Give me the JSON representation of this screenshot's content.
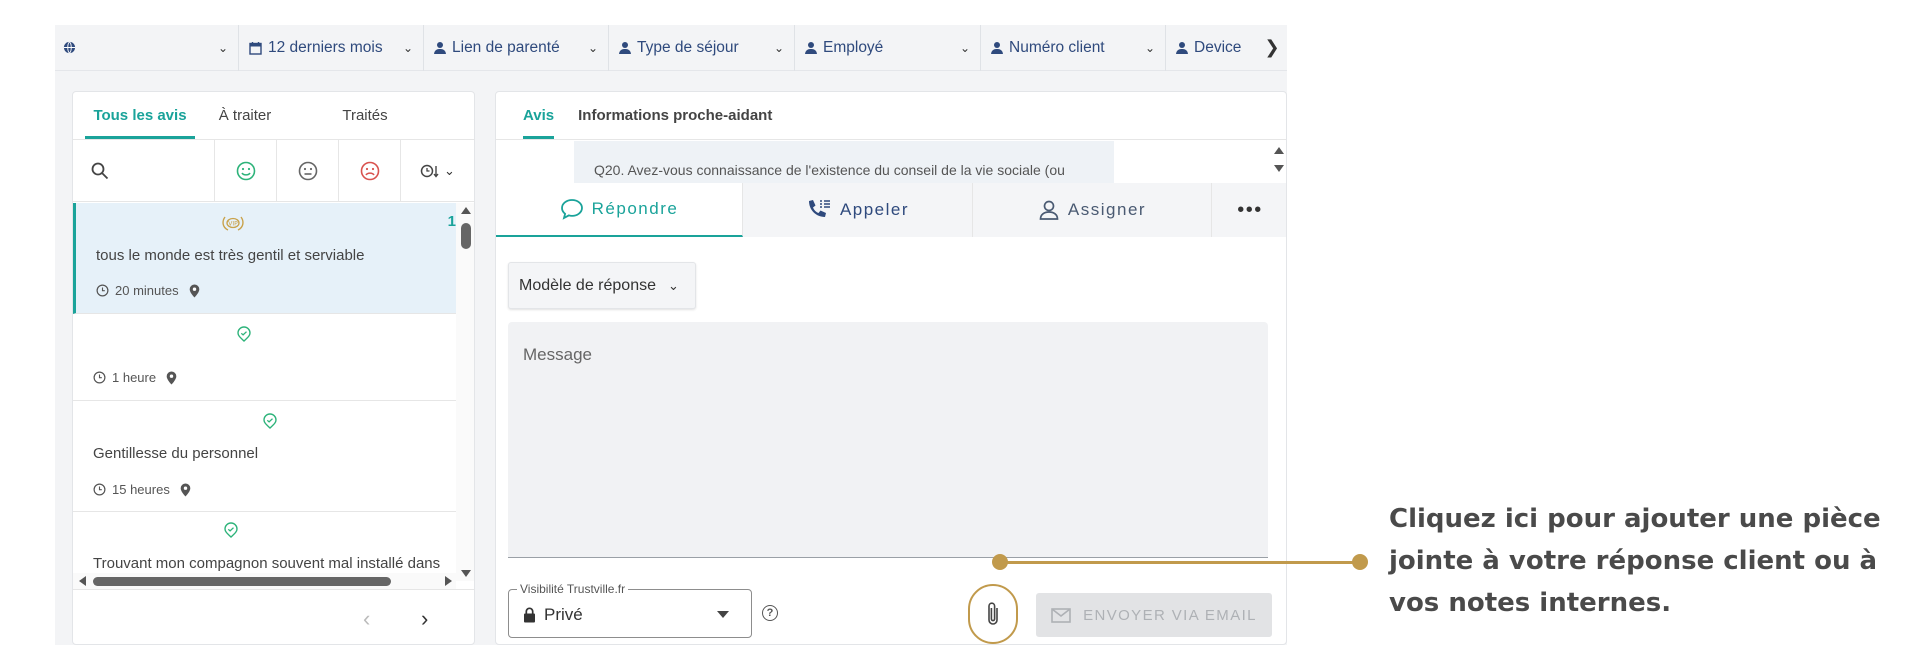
{
  "filters": {
    "period": "12 derniers mois",
    "lien": "Lien de parenté",
    "type_sejour": "Type de séjour",
    "employe": "Employé",
    "numero_client": "Numéro client",
    "device": "Device"
  },
  "left_tabs": [
    "Tous les avis",
    "À traiter",
    "Traités"
  ],
  "reviews": [
    {
      "text": "tous le monde est très gentil et serviable",
      "time": "20 minutes",
      "count": "1"
    },
    {
      "text": "",
      "time": "1 heure"
    },
    {
      "text": "Gentillesse du personnel",
      "time": "15 heures"
    },
    {
      "text": "Trouvant mon compagnon souvent mal installé dans"
    }
  ],
  "right_tabs": [
    "Avis",
    "Informations proche-aidant"
  ],
  "question": "Q20. Avez-vous connaissance de l'existence du conseil de la vie sociale (ou",
  "actions": {
    "reply": "Répondre",
    "call": "Appeler",
    "assign": "Assigner"
  },
  "template_label": "Modèle de réponse",
  "message_placeholder": "Message",
  "visibility": {
    "label": "Visibilité Trustville.fr",
    "value": "Privé"
  },
  "help_glyph": "?",
  "send_label": "ENVOYER VIA EMAIL",
  "callout": "Cliquez ici pour ajouter une pièce jointe à votre réponse client ou à vos notes internes.",
  "colors": {
    "accent": "#1aa39a",
    "callout": "#c19a4c",
    "navy": "#2f4a7d"
  }
}
